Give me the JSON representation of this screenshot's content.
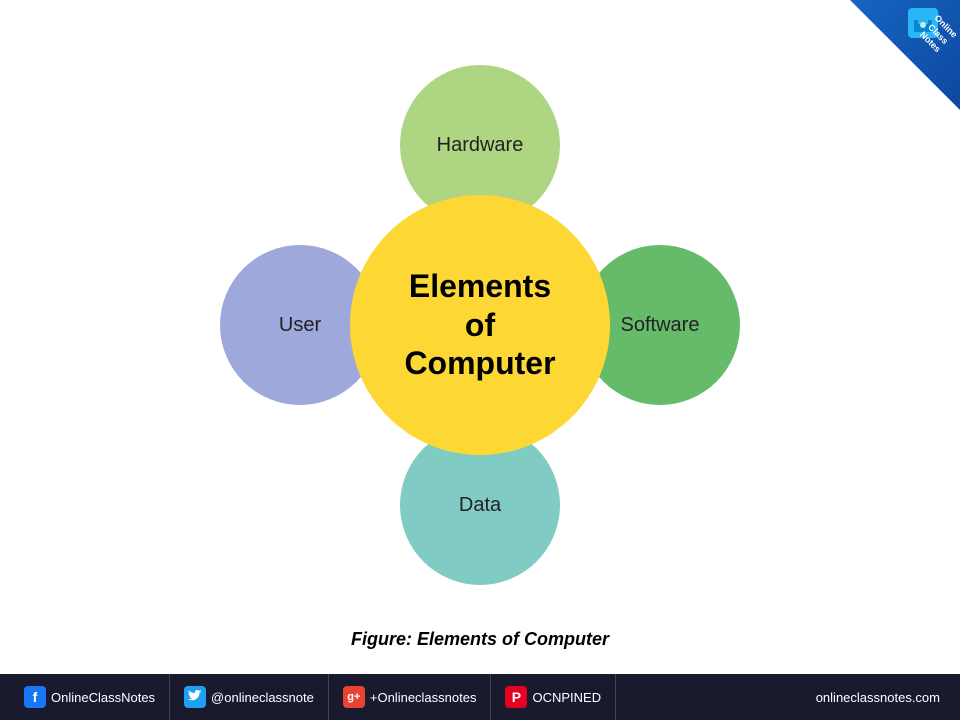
{
  "page": {
    "background": "#ffffff"
  },
  "corner_badge": {
    "line1": "Online",
    "line2": "Class",
    "line3": "Notes"
  },
  "diagram": {
    "center_label": "Elements\nof\nComputer",
    "circles": {
      "top": "Hardware",
      "right": "Software",
      "bottom": "Data",
      "left": "User"
    }
  },
  "caption": "Figure: Elements of Computer",
  "footer": {
    "items": [
      {
        "icon": "f",
        "icon_type": "facebook",
        "text": "OnlineClassNotes"
      },
      {
        "icon": "t",
        "icon_type": "twitter",
        "text": "@onlineclassnote"
      },
      {
        "icon": "g+",
        "icon_type": "gplus",
        "text": "+Onlineclassnotes"
      },
      {
        "icon": "P",
        "icon_type": "pinterest",
        "text": "OCNPINED"
      }
    ],
    "url": "onlineclassnotes.com"
  }
}
